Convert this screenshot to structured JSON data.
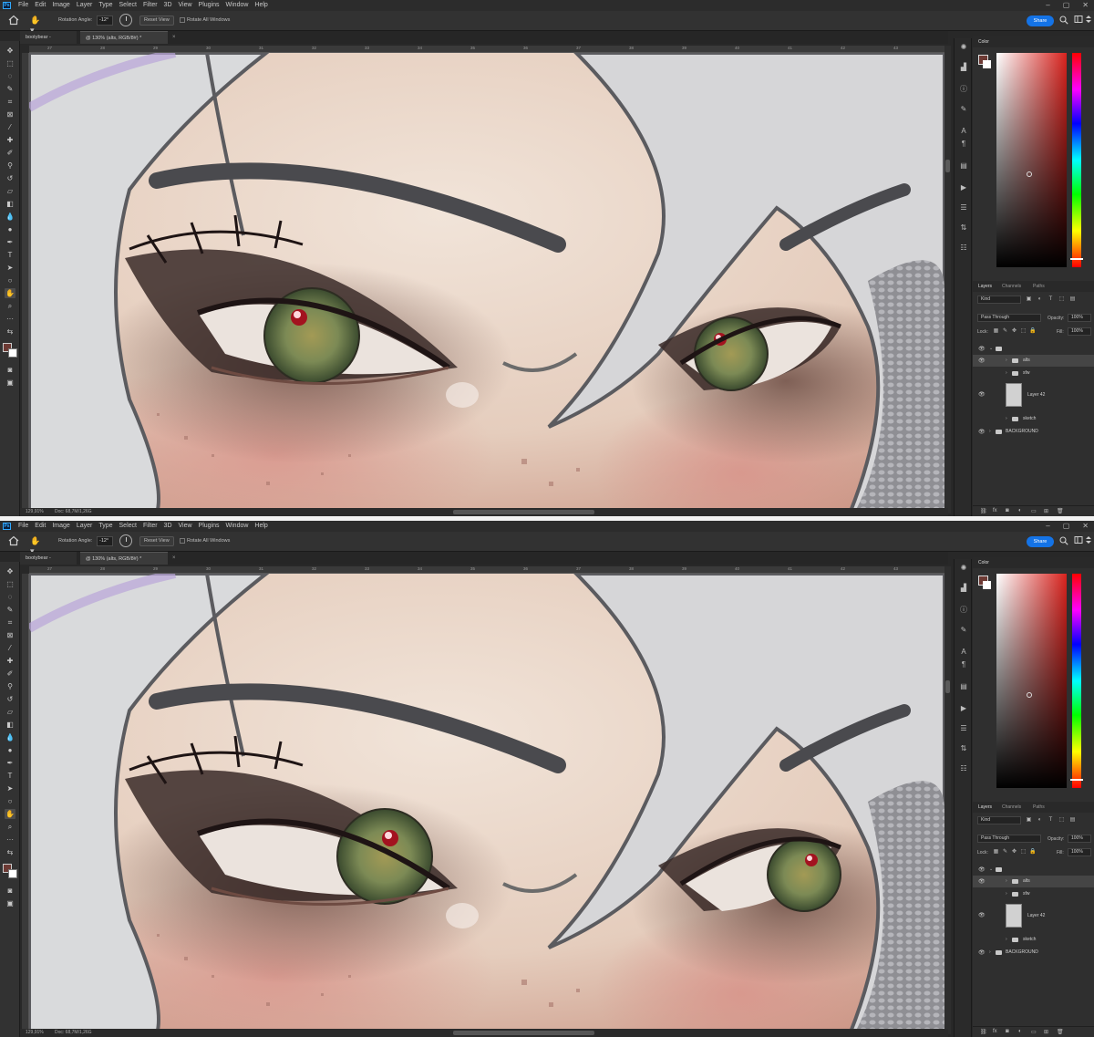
{
  "app": {
    "logo_text": "Ps",
    "menus": [
      "File",
      "Edit",
      "Image",
      "Layer",
      "Type",
      "Select",
      "Filter",
      "3D",
      "View",
      "Plugins",
      "Window",
      "Help"
    ],
    "window_controls": [
      "–",
      "▢",
      "✕"
    ]
  },
  "options_bar": {
    "rotation_label": "Rotation Angle:",
    "rotation_value": "-12°",
    "reset_view": "Reset View",
    "rotate_all_windows": "Rotate All Windows",
    "share": "Share"
  },
  "tabs": [
    {
      "label": "bootybear -"
    },
    {
      "label": "@ 130% (alts, RGB/8#) *",
      "close": "×"
    }
  ],
  "ruler_ticks": [
    "27",
    "28",
    "29",
    "30",
    "31",
    "32",
    "33",
    "34",
    "35",
    "36",
    "37",
    "38",
    "39",
    "40",
    "41",
    "42",
    "43"
  ],
  "status": {
    "zoom": "129,91%",
    "doc": "Doc: 68,7M/1,26G"
  },
  "color_panel": {
    "title": "Color",
    "fg": "#6d3a34",
    "bg": "#ffffff"
  },
  "layers_panel": {
    "tabs": [
      "Layers",
      "Channels",
      "Paths"
    ],
    "kind": "Kind",
    "blend_mode": "Pass Through",
    "opacity_label": "Opacity:",
    "opacity_value": "100%",
    "lock_label": "Lock:",
    "fill_label": "Fill:",
    "fill_value": "100%",
    "layers": [
      {
        "name": "",
        "type": "group",
        "visible": true,
        "indent": 0,
        "expanded": true
      },
      {
        "name": "alts",
        "type": "group",
        "visible": true,
        "indent": 1,
        "selected": true
      },
      {
        "name": "sfw",
        "type": "group",
        "visible": false,
        "indent": 1
      },
      {
        "name": "Layer 42",
        "type": "pixel",
        "visible": true,
        "indent": 1
      },
      {
        "name": "sketch",
        "type": "group",
        "visible": false,
        "indent": 1
      },
      {
        "name": "BACKGROUND",
        "type": "group",
        "visible": true,
        "indent": 0
      }
    ]
  },
  "views": [
    {
      "id": "upper",
      "gaze": "forward"
    },
    {
      "id": "lower",
      "gaze": "side"
    }
  ]
}
